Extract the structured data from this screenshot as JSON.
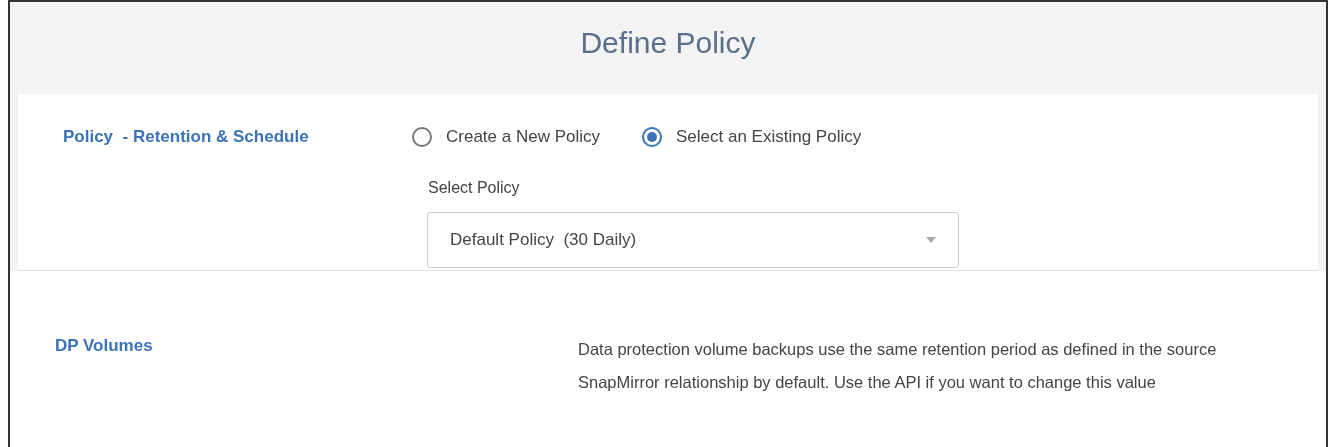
{
  "title": "Define Policy",
  "policy_section": {
    "label": "Policy  - Retention & Schedule",
    "options": [
      {
        "label": "Create a New Policy",
        "selected": false
      },
      {
        "label": "Select an Existing Policy",
        "selected": true
      }
    ],
    "select": {
      "label": "Select Policy",
      "value": "Default Policy  (30 Daily)"
    }
  },
  "dp_section": {
    "label": "DP Volumes",
    "text": "Data protection volume backups use the same retention period as defined in the source SnapMirror relationship by default. Use the API if you want to change this value"
  }
}
